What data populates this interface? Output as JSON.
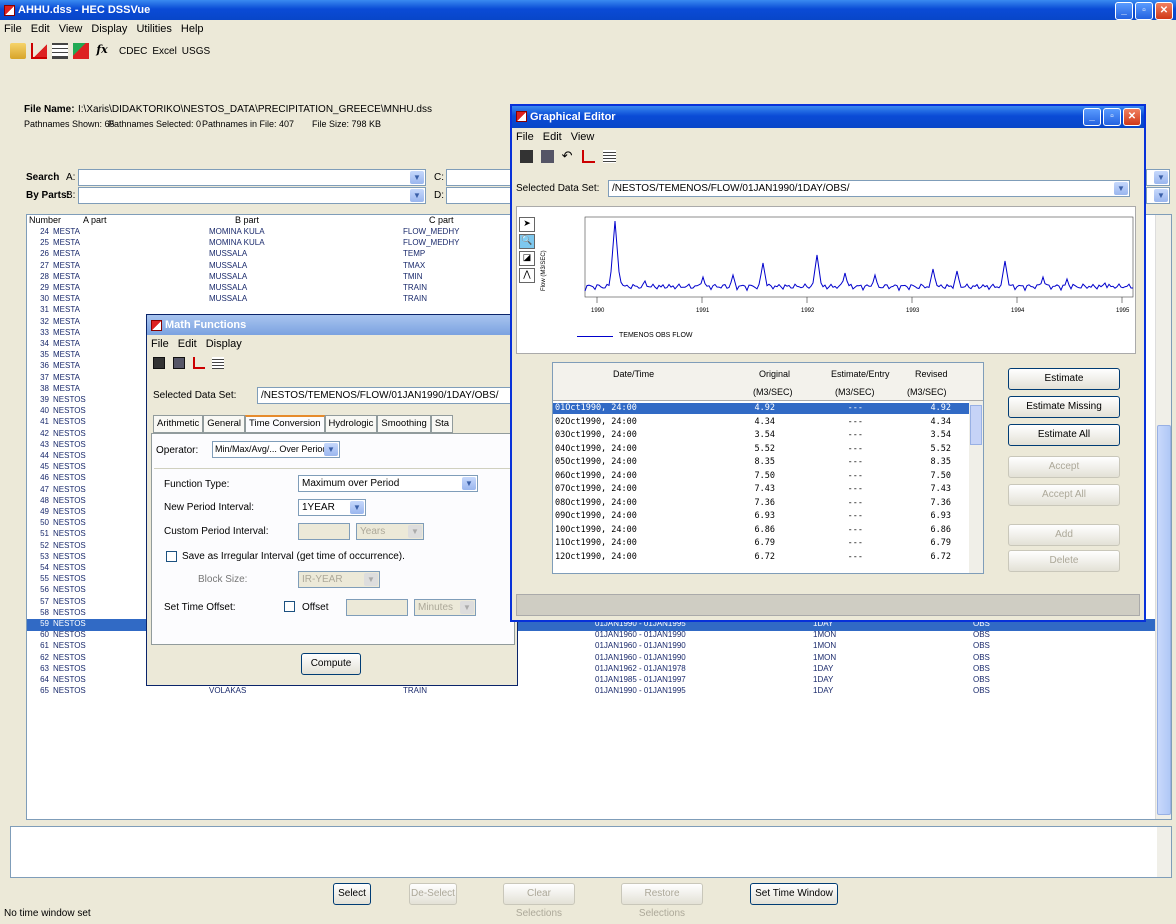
{
  "main_window": {
    "title": "AHHU.dss - HEC DSSVue",
    "menu": [
      "File",
      "Edit",
      "View",
      "Display",
      "Utilities",
      "Help"
    ],
    "toolbar_text": [
      "CDEC",
      "Excel",
      "USGS"
    ],
    "file_name_label": "File Name:",
    "file_name": "I:\\Xaris\\DIDAKTORIKO\\NESTOS_DATA\\PRECIPITATION_GREECE\\MNHU.dss",
    "stats": [
      "Pathnames Shown: 65",
      "Pathnames Selected: 0",
      "Pathnames in File: 407",
      "File Size: 798 KB"
    ],
    "search_label": "Search",
    "byparts_label": "By Parts:",
    "part_a": "A:",
    "part_b": "B:",
    "part_c": "C:",
    "part_d": "D:",
    "columns": [
      "Number",
      "A part",
      "B part",
      "C part"
    ],
    "rows": [
      [
        "24",
        "MESTA",
        "MOMINA KULA",
        "FLOW_MEDHY",
        "",
        "",
        ""
      ],
      [
        "25",
        "MESTA",
        "MOMINA KULA",
        "FLOW_MEDHY",
        "",
        "",
        ""
      ],
      [
        "26",
        "MESTA",
        "MUSSALA",
        "TEMP",
        "",
        "",
        ""
      ],
      [
        "27",
        "MESTA",
        "MUSSALA",
        "TMAX",
        "",
        "",
        ""
      ],
      [
        "28",
        "MESTA",
        "MUSSALA",
        "TMIN",
        "",
        "",
        ""
      ],
      [
        "29",
        "MESTA",
        "MUSSALA",
        "TRAIN",
        "",
        "",
        ""
      ],
      [
        "30",
        "MESTA",
        "MUSSALA",
        "TRAIN",
        "",
        "",
        ""
      ],
      [
        "31",
        "MESTA",
        "",
        "",
        "",
        "",
        ""
      ],
      [
        "32",
        "MESTA",
        "",
        "",
        "",
        "",
        ""
      ],
      [
        "33",
        "MESTA",
        "",
        "",
        "",
        "",
        ""
      ],
      [
        "34",
        "MESTA",
        "",
        "",
        "",
        "",
        ""
      ],
      [
        "35",
        "MESTA",
        "",
        "",
        "",
        "",
        ""
      ],
      [
        "36",
        "MESTA",
        "",
        "",
        "",
        "",
        ""
      ],
      [
        "37",
        "MESTA",
        "",
        "",
        "",
        "",
        ""
      ],
      [
        "38",
        "MESTA",
        "",
        "",
        "",
        "",
        ""
      ],
      [
        "39",
        "NESTOS",
        "",
        "",
        "",
        "",
        ""
      ],
      [
        "40",
        "NESTOS",
        "",
        "",
        "",
        "",
        ""
      ],
      [
        "41",
        "NESTOS",
        "",
        "",
        "",
        "",
        ""
      ],
      [
        "42",
        "NESTOS",
        "",
        "",
        "",
        "",
        ""
      ],
      [
        "43",
        "NESTOS",
        "",
        "",
        "",
        "",
        ""
      ],
      [
        "44",
        "NESTOS",
        "",
        "",
        "",
        "",
        ""
      ],
      [
        "45",
        "NESTOS",
        "",
        "",
        "",
        "",
        ""
      ],
      [
        "46",
        "NESTOS",
        "",
        "",
        "",
        "",
        ""
      ],
      [
        "47",
        "NESTOS",
        "",
        "",
        "",
        "",
        ""
      ],
      [
        "48",
        "NESTOS",
        "",
        "",
        "",
        "",
        ""
      ],
      [
        "49",
        "NESTOS",
        "",
        "",
        "",
        "",
        ""
      ],
      [
        "50",
        "NESTOS",
        "",
        "",
        "",
        "",
        ""
      ],
      [
        "51",
        "NESTOS",
        "",
        "",
        "",
        "",
        ""
      ],
      [
        "52",
        "NESTOS",
        "",
        "",
        "",
        "",
        ""
      ],
      [
        "53",
        "NESTOS",
        "",
        "",
        "01JAN1983 - 01JAN1984",
        "1DAY",
        "OBS"
      ],
      [
        "54",
        "NESTOS",
        "",
        "",
        "01JAN1960 - 01JAN1990",
        "1MON",
        "OBS"
      ],
      [
        "55",
        "NESTOS",
        "",
        "",
        "01JAN1960 - 01JAN1990",
        "1MON",
        "OBS"
      ],
      [
        "56",
        "NESTOS",
        "",
        "",
        "01JAN1986 - 01JAN1998",
        "1DAY",
        "OBS"
      ],
      [
        "57",
        "NESTOS",
        "",
        "",
        "01JAN1960 - 01JAN1990",
        "1MON",
        "OBS"
      ],
      [
        "58",
        "NESTOS",
        "",
        "",
        "01JAN1990 - 01JAN1993",
        "1DAY",
        "OBS"
      ],
      [
        "59",
        "NESTOS",
        "TEMENOS",
        "FLOW",
        "01JAN1990 - 01JAN1995",
        "1DAY",
        "OBS"
      ],
      [
        "60",
        "NESTOS",
        "TEMENOS",
        "FLOW",
        "01JAN1960 - 01JAN1990",
        "1MON",
        "OBS"
      ],
      [
        "61",
        "NESTOS",
        "TEMENOS",
        "FLOW_MEDHYCOS",
        "01JAN1960 - 01JAN1990",
        "1MON",
        "OBS"
      ],
      [
        "62",
        "NESTOS",
        "THISAVROS",
        "FLOW",
        "01JAN1960 - 01JAN1990",
        "1MON",
        "OBS"
      ],
      [
        "63",
        "NESTOS",
        "TOKOTES",
        "FLOW",
        "01JAN1962 - 01JAN1978",
        "1DAY",
        "OBS"
      ],
      [
        "64",
        "NESTOS",
        "TOKOTES",
        "TRAIN",
        "01JAN1985 - 01JAN1997",
        "1DAY",
        "OBS"
      ],
      [
        "65",
        "NESTOS",
        "VOLAKAS",
        "TRAIN",
        "01JAN1990 - 01JAN1995",
        "1DAY",
        "OBS"
      ]
    ],
    "bottom_buttons": [
      "Select",
      "De-Select",
      "Clear Selections",
      "Restore Selections",
      "Set Time Window"
    ],
    "status": "No time window set"
  },
  "math": {
    "title": "Math Functions",
    "menu": [
      "File",
      "Edit",
      "Display"
    ],
    "selected_label": "Selected Data Set:",
    "selected_value": "/NESTOS/TEMENOS/FLOW/01JAN1990/1DAY/OBS/",
    "tabs": [
      "Arithmetic",
      "General",
      "Time Conversion",
      "Hydrologic",
      "Smoothing",
      "Sta"
    ],
    "operator_label": "Operator:",
    "operator_value": "Min/Max/Avg/... Over Period",
    "function_type_label": "Function Type:",
    "function_type_value": "Maximum over Period",
    "new_period_label": "New Period Interval:",
    "new_period_value": "1YEAR",
    "custom_period_label": "Custom Period Interval:",
    "custom_units": "Years",
    "save_irregular_label": "Save as Irregular Interval (get time of occurrence).",
    "block_size_label": "Block Size:",
    "block_size_value": "IR-YEAR",
    "set_time_offset_label": "Set Time Offset:",
    "offset_label": "Offset",
    "offset_units": "Minutes",
    "compute": "Compute"
  },
  "graph": {
    "title": "Graphical Editor",
    "menu": [
      "File",
      "Edit",
      "View"
    ],
    "selected_label": "Selected Data Set:",
    "selected_value": "/NESTOS/TEMENOS/FLOW/01JAN1990/1DAY/OBS/",
    "ylabel": "Flow (M3/SEC)",
    "legend": "TEMENOS OBS FLOW",
    "x_ticks": [
      "1990",
      "1991",
      "1992",
      "1993",
      "1994",
      "1995"
    ],
    "table_headers": [
      [
        "Date/Time",
        ""
      ],
      [
        "Original",
        "(M3/SEC)"
      ],
      [
        "Estimate/Entry",
        "(M3/SEC)"
      ],
      [
        "Revised",
        "(M3/SEC)"
      ]
    ],
    "rows": [
      [
        "01Oct1990, 24:00",
        "4.92",
        "---",
        "4.92"
      ],
      [
        "02Oct1990, 24:00",
        "4.34",
        "---",
        "4.34"
      ],
      [
        "03Oct1990, 24:00",
        "3.54",
        "---",
        "3.54"
      ],
      [
        "04Oct1990, 24:00",
        "5.52",
        "---",
        "5.52"
      ],
      [
        "05Oct1990, 24:00",
        "8.35",
        "---",
        "8.35"
      ],
      [
        "06Oct1990, 24:00",
        "7.50",
        "---",
        "7.50"
      ],
      [
        "07Oct1990, 24:00",
        "7.43",
        "---",
        "7.43"
      ],
      [
        "08Oct1990, 24:00",
        "7.36",
        "---",
        "7.36"
      ],
      [
        "09Oct1990, 24:00",
        "6.93",
        "---",
        "6.93"
      ],
      [
        "10Oct1990, 24:00",
        "6.86",
        "---",
        "6.86"
      ],
      [
        "11Oct1990, 24:00",
        "6.79",
        "---",
        "6.79"
      ],
      [
        "12Oct1990, 24:00",
        "6.72",
        "---",
        "6.72"
      ]
    ],
    "buttons": [
      "Estimate",
      "Estimate Missing",
      "Estimate All",
      "Accept",
      "Accept All",
      "Add",
      "Delete"
    ]
  }
}
